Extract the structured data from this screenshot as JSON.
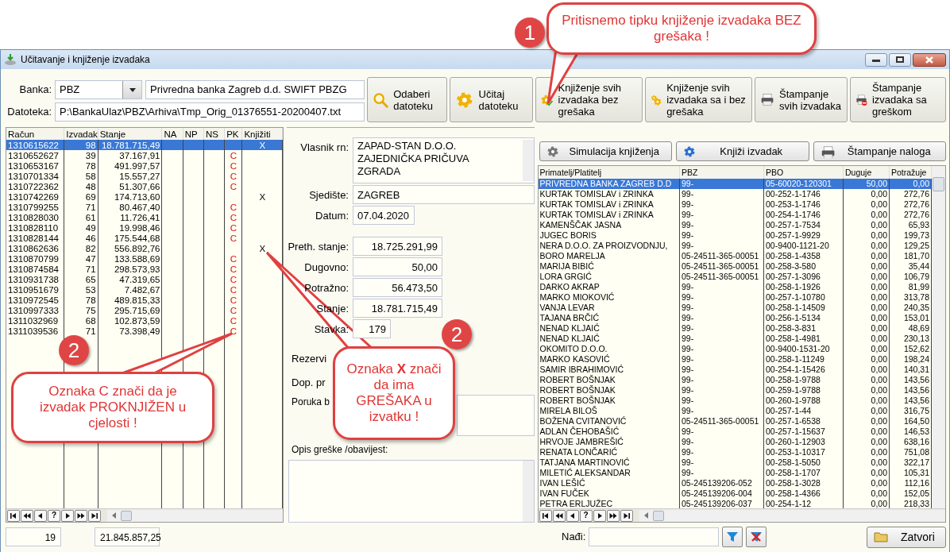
{
  "window": {
    "title": "Učitavanje i knjiženje izvadaka"
  },
  "bank": {
    "label": "Banka:",
    "code": "PBZ",
    "name": "Privredna banka Zagreb d.d. SWIFT PBZG"
  },
  "file": {
    "label": "Datoteka:",
    "value": "P:\\BankaUlaz\\PBZ\\Arhiva\\Tmp_Orig_01376551-20200407.txt"
  },
  "toolbar": [
    {
      "kind": "magnifier",
      "label": "Odaberi datoteku"
    },
    {
      "kind": "gear",
      "label": "Učitaj datoteku"
    },
    {
      "kind": "gear-check",
      "label": "Knjiženje svih izvadaka bez grešaka"
    },
    {
      "kind": "gears",
      "label": "Knjiženje svih izvadaka sa i bez grešaka"
    },
    {
      "kind": "printer",
      "label": "Štampanje svih izvadaka"
    },
    {
      "kind": "printer-stop",
      "label": "Štampanje izvadaka sa greškom"
    }
  ],
  "statements": {
    "columns": [
      "Račun",
      "Izvadak",
      "Stanje",
      "NA",
      "NP",
      "NS",
      "PK",
      "Knjižiti"
    ],
    "rows": [
      {
        "account": "1310615622",
        "number": "98",
        "balance": "18.781.715,49",
        "book": "X",
        "selected": true
      },
      {
        "account": "1310652627",
        "number": "39",
        "balance": "37.167,91",
        "pk": "C",
        "selected": false
      },
      {
        "account": "1310653167",
        "number": "78",
        "balance": "491.997,57",
        "pk": "C",
        "selected": false
      },
      {
        "account": "1310701334",
        "number": "58",
        "balance": "15.557,27",
        "pk": "C",
        "selected": false
      },
      {
        "account": "1310722362",
        "number": "48",
        "balance": "51.307,66",
        "pk": "C",
        "selected": false
      },
      {
        "account": "1310742269",
        "number": "69",
        "balance": "174.713,60",
        "book": "X",
        "selected": false
      },
      {
        "account": "1310799255",
        "number": "71",
        "balance": "80.467,40",
        "pk": "C",
        "selected": false
      },
      {
        "account": "1310828030",
        "number": "61",
        "balance": "11.726,41",
        "pk": "C",
        "selected": false
      },
      {
        "account": "1310828110",
        "number": "49",
        "balance": "19.998,46",
        "pk": "C",
        "selected": false
      },
      {
        "account": "1310828144",
        "number": "46",
        "balance": "175.544,68",
        "pk": "C",
        "selected": false
      },
      {
        "account": "1310862636",
        "number": "82",
        "balance": "556.892,76",
        "book": "X",
        "selected": false
      },
      {
        "account": "1310870799",
        "number": "47",
        "balance": "133.588,69",
        "pk": "C",
        "selected": false
      },
      {
        "account": "1310874584",
        "number": "71",
        "balance": "298.573,93",
        "pk": "C",
        "selected": false
      },
      {
        "account": "1310931738",
        "number": "65",
        "balance": "47.319,65",
        "pk": "C",
        "selected": false
      },
      {
        "account": "1310951679",
        "number": "53",
        "balance": "7.482,67",
        "pk": "C",
        "selected": false
      },
      {
        "account": "1310972545",
        "number": "78",
        "balance": "489.815,33",
        "pk": "C",
        "selected": false
      },
      {
        "account": "1310997333",
        "number": "75",
        "balance": "295.715,69",
        "pk": "C",
        "selected": false
      },
      {
        "account": "1311032969",
        "number": "68",
        "balance": "102.873,59",
        "pk": "C",
        "selected": false
      },
      {
        "account": "1311039536",
        "number": "71",
        "balance": "73.398,49",
        "pk": "C",
        "selected": false
      }
    ],
    "navigator": [
      {
        "kind": "first"
      },
      {
        "kind": "prev-page"
      },
      {
        "kind": "prev"
      },
      {
        "kind": "help",
        "label": "?"
      },
      {
        "kind": "next"
      },
      {
        "kind": "next-page"
      },
      {
        "kind": "last"
      }
    ]
  },
  "details": {
    "owner": {
      "label": "Vlasnik rn:",
      "lines": [
        "ZAPAD-STAN D.O.O.",
        "ZAJEDNIČKA PRIČUVA",
        "ZGRADA"
      ]
    },
    "seat": {
      "label": "Sjedište:",
      "value": "ZAGREB"
    },
    "date": {
      "label": "Datum:",
      "value": "07.04.2020"
    },
    "amounts": [
      {
        "label": "Preth. stanje:",
        "value": "18.725.291,99"
      },
      {
        "label": "Dugovno:",
        "value": "50,00"
      },
      {
        "label": "Potražno:",
        "value": "56.473,50"
      },
      {
        "label": "Stanje:",
        "value": "18.781.715,49"
      },
      {
        "label": "Stavka:",
        "value": "179"
      }
    ],
    "reserved_label": "Rezervi",
    "extra_label": "Dop. pr",
    "message_label": "Poruka b",
    "error_label": "Opis greške /obavijest:"
  },
  "actions": [
    {
      "kind": "gear",
      "label": "Simulacija knjiženja"
    },
    {
      "kind": "gear-blue",
      "label": "Knjiži izvadak"
    },
    {
      "kind": "printer",
      "label": "Štampanje naloga"
    }
  ],
  "items": {
    "columns": [
      "Primatelj/Platitelj",
      "PBZ",
      "PBO",
      "Duguje",
      "Potražuje"
    ],
    "rows": [
      {
        "cells": [
          "PRIVREDNA BANKA ZAGREB D.D",
          "99-",
          "05-60020-120301",
          "50,00",
          "0,00"
        ],
        "selected": true
      },
      {
        "cells": [
          "KURTAK TOMISLAV i ZRINKA",
          "99-",
          "00-252-1-1746",
          "0,00",
          "272,76"
        ],
        "selected": false
      },
      {
        "cells": [
          "KURTAK TOMISLAV i ZRINKA",
          "99-",
          "00-253-1-1746",
          "0,00",
          "272,76"
        ],
        "selected": false
      },
      {
        "cells": [
          "KURTAK TOMISLAV i ZRINKA",
          "99-",
          "00-254-1-1746",
          "0,00",
          "272,76"
        ],
        "selected": false
      },
      {
        "cells": [
          "KAMENŠČAK JASNA",
          "99-",
          "00-257-1-7534",
          "0,00",
          "65,93"
        ],
        "selected": false
      },
      {
        "cells": [
          "JUGEC BORIS",
          "99-",
          "00-257-1-9929",
          "0,00",
          "199,73"
        ],
        "selected": false
      },
      {
        "cells": [
          "NERA D.O.O. ZA PROIZVODNJU,",
          "99-",
          "00-9400-1121-20",
          "0,00",
          "129,25"
        ],
        "selected": false
      },
      {
        "cells": [
          "BORO MARELJA",
          "05-24511-365-00051",
          "00-258-1-4358",
          "0,00",
          "181,70"
        ],
        "selected": false
      },
      {
        "cells": [
          "MARIJA BIBIĆ",
          "05-24511-365-00051",
          "00-258-3-580",
          "0,00",
          "35,44"
        ],
        "selected": false
      },
      {
        "cells": [
          "LORA GRGIĆ",
          "05-24511-365-00051",
          "00-257-1-3096",
          "0,00",
          "106,79"
        ],
        "selected": false
      },
      {
        "cells": [
          "DARKO AKRAP",
          "99-",
          "00-258-1-1926",
          "0,00",
          "81,99"
        ],
        "selected": false
      },
      {
        "cells": [
          "MARKO MIOKOVIĆ",
          "99-",
          "00-257-1-10780",
          "0,00",
          "313,78"
        ],
        "selected": false
      },
      {
        "cells": [
          "VANJA LEVAR",
          "99-",
          "00-258-1-14509",
          "0,00",
          "240,35"
        ],
        "selected": false
      },
      {
        "cells": [
          "TAJANA BRČIĆ",
          "99-",
          "00-256-1-5134",
          "0,00",
          "153,01"
        ],
        "selected": false
      },
      {
        "cells": [
          "NENAD KLJAIĆ",
          "99-",
          "00-258-3-831",
          "0,00",
          "48,69"
        ],
        "selected": false
      },
      {
        "cells": [
          "NENAD KLJAIĆ",
          "99-",
          "00-258-1-4981",
          "0,00",
          "230,13"
        ],
        "selected": false
      },
      {
        "cells": [
          "OKOMITO D.O.O.",
          "99-",
          "00-9400-1531-20",
          "0,00",
          "152,62"
        ],
        "selected": false
      },
      {
        "cells": [
          "MARKO KASOVIĆ",
          "99-",
          "00-258-1-11249",
          "0,00",
          "198,24"
        ],
        "selected": false
      },
      {
        "cells": [
          "SAMIR IBRAHIMOVIĆ",
          "99-",
          "00-254-1-15426",
          "0,00",
          "140,31"
        ],
        "selected": false
      },
      {
        "cells": [
          "ROBERT BOŠNJAK",
          "99-",
          "00-258-1-9788",
          "0,00",
          "143,56"
        ],
        "selected": false
      },
      {
        "cells": [
          "ROBERT BOŠNJAK",
          "99-",
          "00-259-1-9788",
          "0,00",
          "143,56"
        ],
        "selected": false
      },
      {
        "cells": [
          "ROBERT BOŠNJAK",
          "99-",
          "00-260-1-9788",
          "0,00",
          "143,56"
        ],
        "selected": false
      },
      {
        "cells": [
          "MIRELA BILOŠ",
          "99-",
          "00-257-1-44",
          "0,00",
          "316,75"
        ],
        "selected": false
      },
      {
        "cells": [
          "BOŽENA CVITANOVIĆ",
          "05-24511-365-00051",
          "00-257-1-6538",
          "0,00",
          "164,50"
        ],
        "selected": false
      },
      {
        "cells": [
          "ADLAN ČEHOBAŠIĆ",
          "99-",
          "00-257-1-15637",
          "0,00",
          "146,53"
        ],
        "selected": false
      },
      {
        "cells": [
          "HRVOJE JAMBREŠIĆ",
          "99-",
          "00-260-1-12903",
          "0,00",
          "638,16"
        ],
        "selected": false
      },
      {
        "cells": [
          "RENATA LONČARIĆ",
          "99-",
          "00-253-1-10317",
          "0,00",
          "751,08"
        ],
        "selected": false
      },
      {
        "cells": [
          "TATJANA MARTINOVIĆ",
          "99-",
          "00-258-1-5050",
          "0,00",
          "322,17"
        ],
        "selected": false
      },
      {
        "cells": [
          "MILETIĆ ALEKSANDAR",
          "99-",
          "00-258-1-1707",
          "0,00",
          "105,31"
        ],
        "selected": false
      },
      {
        "cells": [
          "IVAN LEŠIĆ",
          "05-245139206-052",
          "00-258-1-3028",
          "0,00",
          "112,16"
        ],
        "selected": false
      },
      {
        "cells": [
          "IVAN FUČEK",
          "05-245139206-004",
          "00-258-1-4366",
          "0,00",
          "152,05"
        ],
        "selected": false
      },
      {
        "cells": [
          "PETRA ERLJUŽEC",
          "05-245139206-037",
          "00-254-1-12",
          "0,00",
          "218,33"
        ],
        "selected": false
      }
    ],
    "navigator": [
      {
        "kind": "first"
      },
      {
        "kind": "prev-page"
      },
      {
        "kind": "prev"
      },
      {
        "kind": "help",
        "label": "?"
      },
      {
        "kind": "next"
      },
      {
        "kind": "next-page"
      },
      {
        "kind": "last"
      }
    ]
  },
  "footer": {
    "count": "19",
    "total": "21.845.857,25",
    "search_label": "Nađi:",
    "close_label": "Zatvori"
  },
  "annotations": [
    {
      "number": "1",
      "text": "Pritisnemo tipku knjiženje izvadaka BEZ grešaka !"
    },
    {
      "number": "2",
      "text": "Oznaka C znači da je izvadak PROKNJIŽEN u cjelosti !"
    },
    {
      "number": "2",
      "text": "Oznaka **X** znači da ima GREŠAKA u izvatku !"
    }
  ]
}
